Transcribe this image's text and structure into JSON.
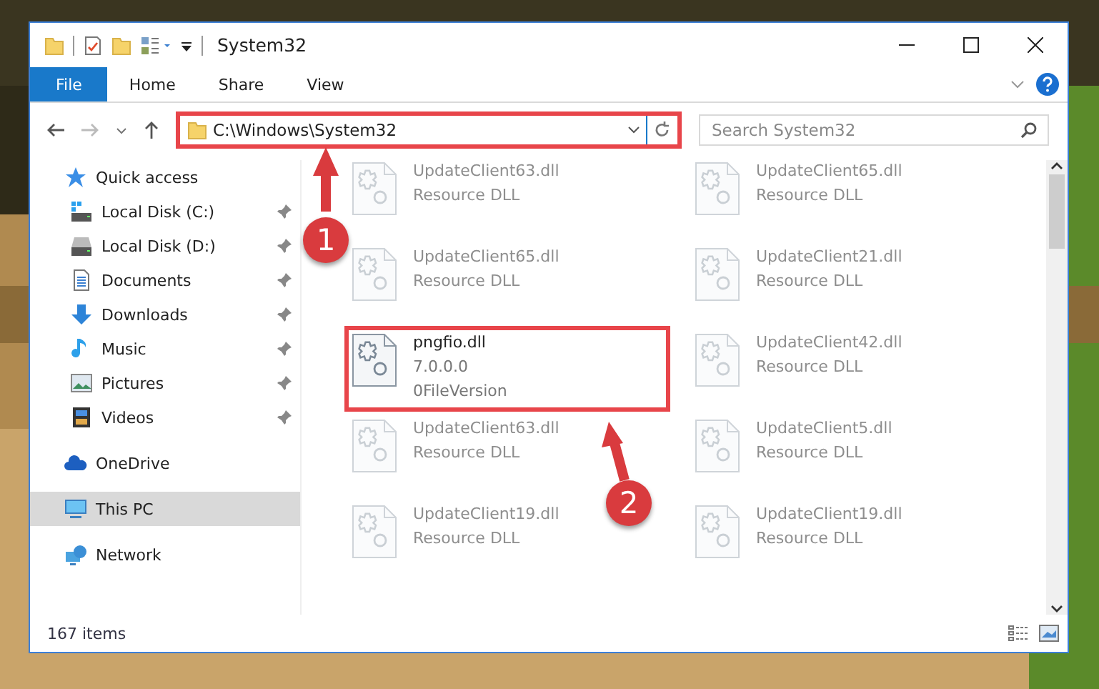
{
  "window": {
    "title": "System32"
  },
  "ribbon_tabs": [
    {
      "label": "File",
      "kind": "file"
    },
    {
      "label": "Home",
      "kind": "tab"
    },
    {
      "label": "Share",
      "kind": "tab"
    },
    {
      "label": "View",
      "kind": "tab"
    }
  ],
  "address": {
    "value": "C:\\Windows\\System32",
    "highlighted": true
  },
  "search": {
    "placeholder": "Search System32"
  },
  "sidebar": {
    "items": [
      {
        "label": "Quick access",
        "kind": "quick-access",
        "selected": false,
        "children": [
          {
            "label": "Local Disk (C:)",
            "kind": "system-drive",
            "pinned": true
          },
          {
            "label": "Local Disk (D:)",
            "kind": "drive",
            "pinned": true
          },
          {
            "label": "Documents",
            "kind": "documents",
            "pinned": true
          },
          {
            "label": "Downloads",
            "kind": "downloads",
            "pinned": true
          },
          {
            "label": "Music",
            "kind": "music",
            "pinned": true
          },
          {
            "label": "Pictures",
            "kind": "pictures",
            "pinned": true
          },
          {
            "label": "Videos",
            "kind": "videos",
            "pinned": true
          }
        ]
      },
      {
        "label": "OneDrive",
        "kind": "cloud",
        "selected": false
      },
      {
        "label": "This PC",
        "kind": "computer",
        "selected": true
      },
      {
        "label": "Network",
        "kind": "network",
        "selected": false
      }
    ]
  },
  "files": [
    {
      "name": "UpdateClient63.dll",
      "details": [
        "Resource DLL"
      ],
      "dimmed": true,
      "highlighted": false
    },
    {
      "name": "UpdateClient65.dll",
      "details": [
        "Resource DLL"
      ],
      "dimmed": true,
      "highlighted": false
    },
    {
      "name": "UpdateClient65.dll",
      "details": [
        "Resource DLL"
      ],
      "dimmed": true,
      "highlighted": false
    },
    {
      "name": "UpdateClient21.dll",
      "details": [
        "Resource DLL"
      ],
      "dimmed": true,
      "highlighted": false
    },
    {
      "name": "pngfio.dll",
      "details": [
        "7.0.0.0",
        "0FileVersion"
      ],
      "dimmed": false,
      "highlighted": true
    },
    {
      "name": "UpdateClient42.dll",
      "details": [
        "Resource DLL"
      ],
      "dimmed": true,
      "highlighted": false
    },
    {
      "name": "UpdateClient63.dll",
      "details": [
        "Resource DLL"
      ],
      "dimmed": true,
      "highlighted": false
    },
    {
      "name": "UpdateClient5.dll",
      "details": [
        "Resource DLL"
      ],
      "dimmed": true,
      "highlighted": false
    },
    {
      "name": "UpdateClient19.dll",
      "details": [
        "Resource DLL"
      ],
      "dimmed": true,
      "highlighted": false
    },
    {
      "name": "UpdateClient19.dll",
      "details": [
        "Resource DLL"
      ],
      "dimmed": true,
      "highlighted": false
    }
  ],
  "status_bar": {
    "text": "167 items"
  },
  "annotations": [
    {
      "number": "1"
    },
    {
      "number": "2"
    }
  ]
}
